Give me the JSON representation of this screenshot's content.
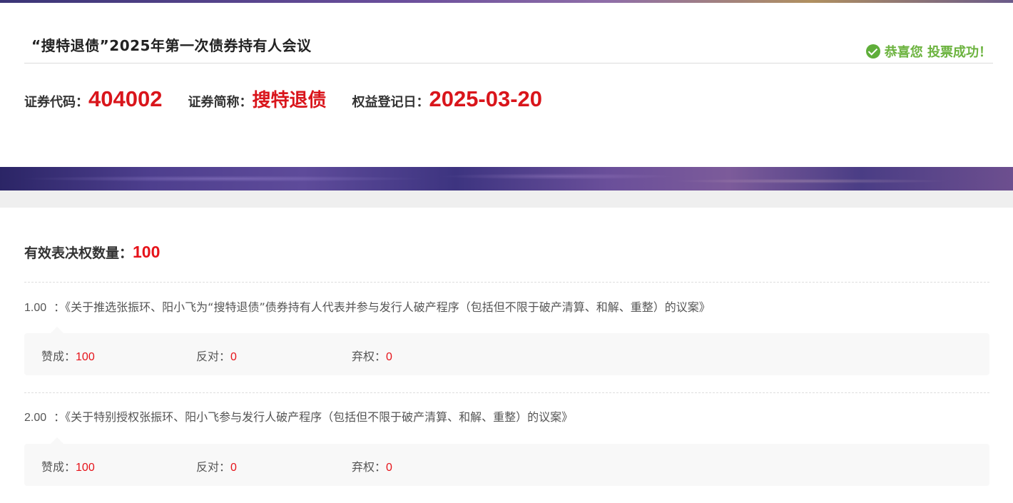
{
  "header": {
    "meeting_title": "“搜特退债”2025年第一次债券持有人会议",
    "success_message": "恭喜您 投票成功！"
  },
  "info": {
    "code_label": "证券代码：",
    "code_value": "404002",
    "short_label": "证券简称：",
    "short_value": "搜特退债",
    "record_label": "权益登记日：",
    "record_value": "2025-03-20"
  },
  "votes": {
    "label": "有效表决权数量：",
    "value": "100"
  },
  "motions": [
    {
      "number": "1.00",
      "separator": "：",
      "title": "《关于推选张振环、阳小飞为“搜特退债”债券持有人代表并参与发行人破产程序（包括但不限于破产清算、和解、重整）的议案》",
      "for_label": "赞成：",
      "for_value": "100",
      "against_label": "反对：",
      "against_value": "0",
      "abstain_label": "弃权：",
      "abstain_value": "0"
    },
    {
      "number": "2.00",
      "separator": "：",
      "title": "《关于特别授权张振环、阳小飞参与发行人破产程序（包括但不限于破产清算、和解、重整）的议案》",
      "for_label": "赞成：",
      "for_value": "100",
      "against_label": "反对：",
      "against_value": "0",
      "abstain_label": "弃权：",
      "abstain_value": "0"
    }
  ],
  "colors": {
    "accent_red": "#e6131a",
    "success_green": "#6cb33f"
  }
}
